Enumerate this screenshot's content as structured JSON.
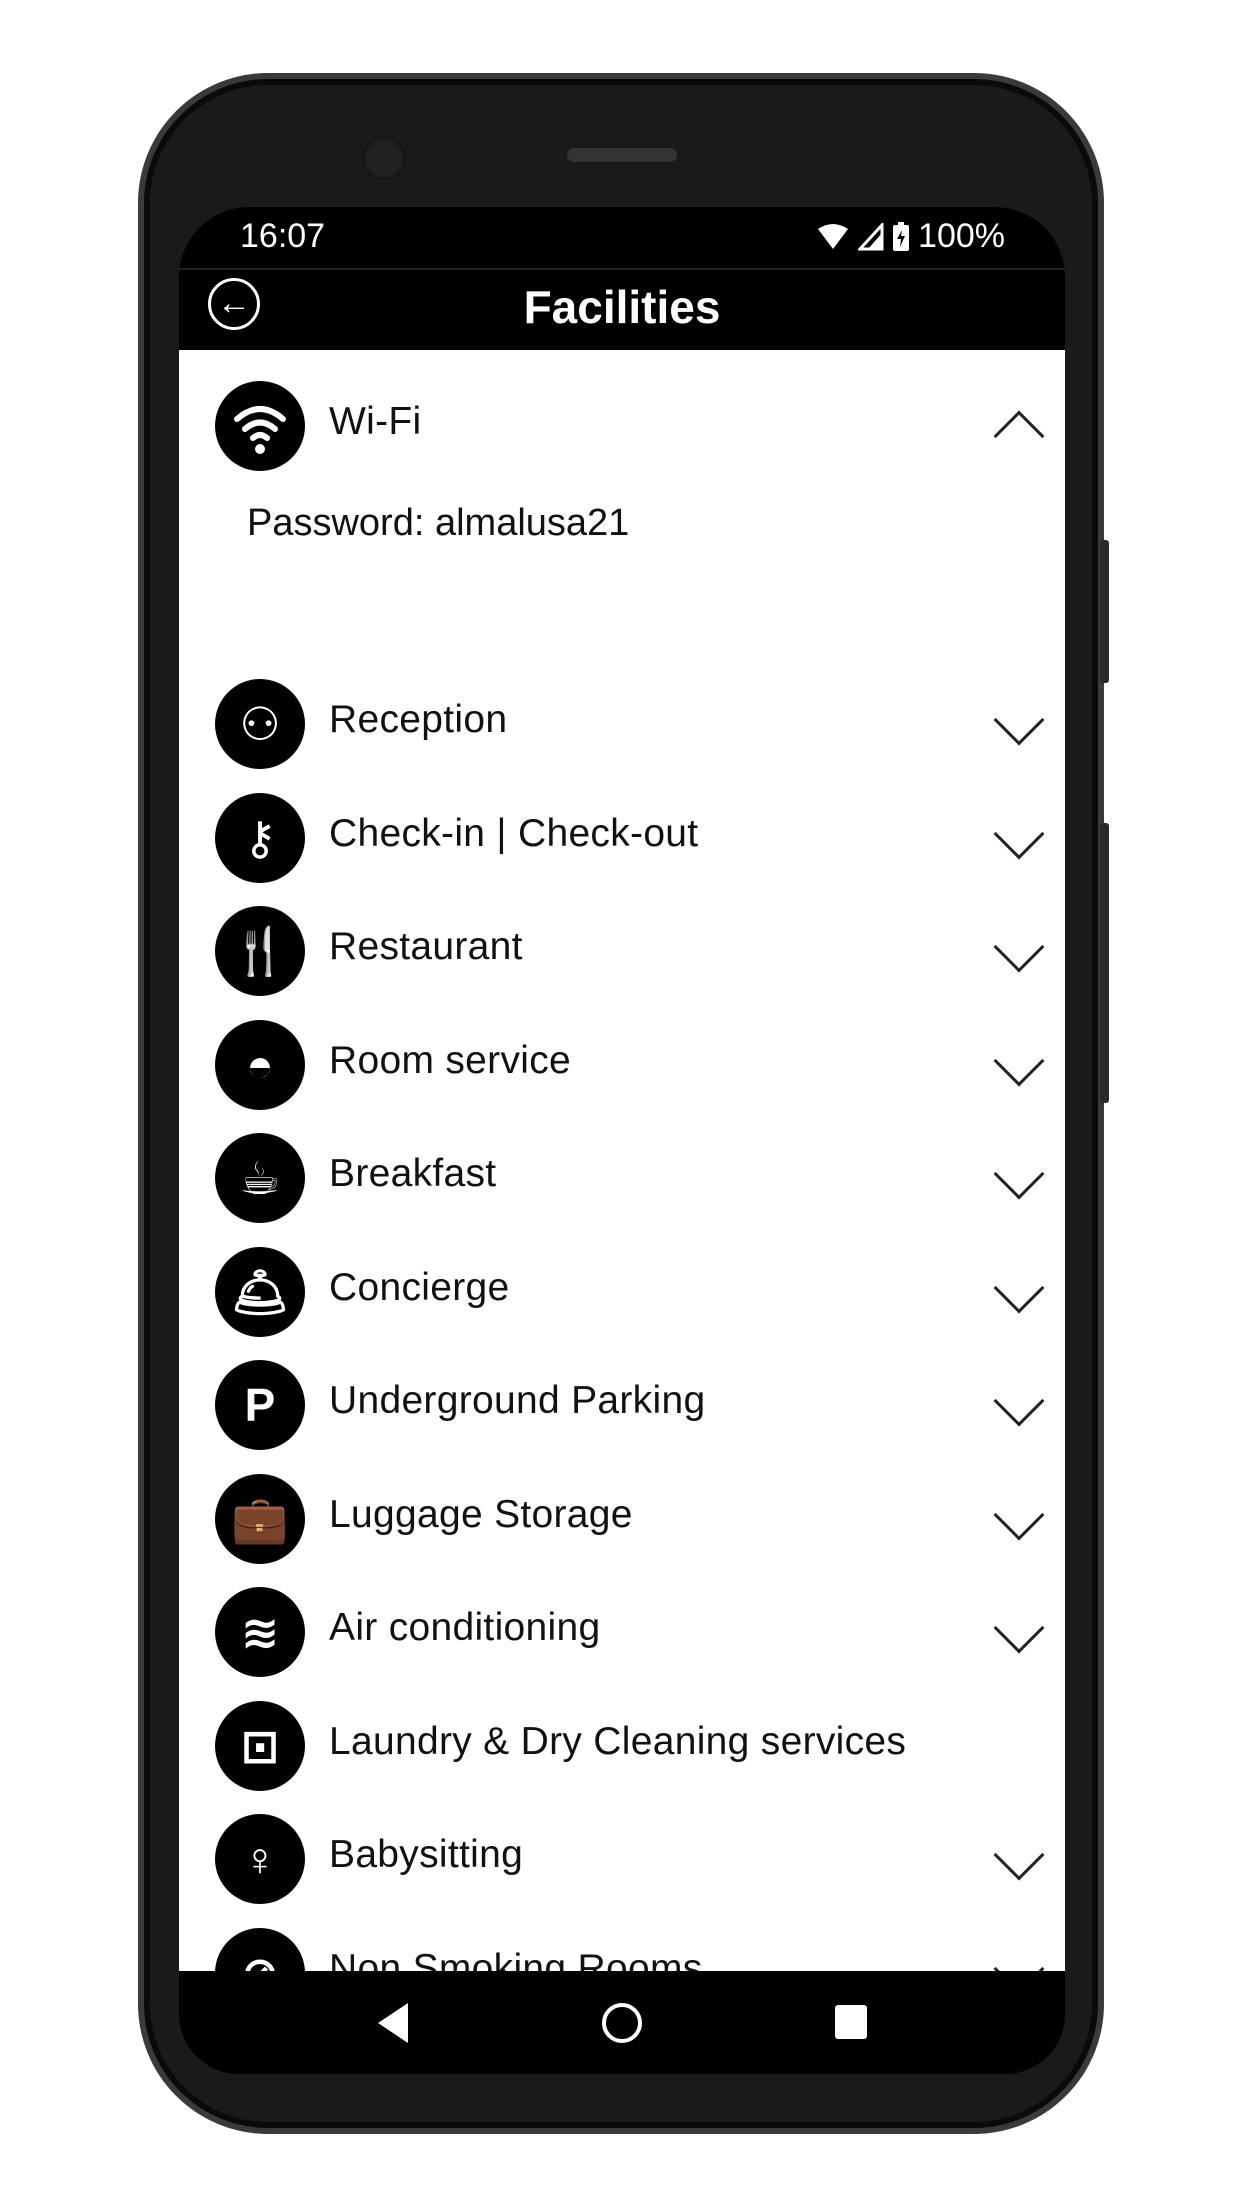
{
  "status_bar": {
    "time": "16:07",
    "battery": "100%",
    "icons": [
      "wifi-icon",
      "signal-icon",
      "battery-charging-icon"
    ]
  },
  "header": {
    "title": "Facilities",
    "back_icon": "arrow-left-circle-icon"
  },
  "wifi": {
    "label": "Wi-Fi",
    "icon": "wifi-icon",
    "expanded": true,
    "detail": "Password: almalusa21"
  },
  "items": [
    {
      "label": "Reception",
      "icon": "reception-icon",
      "chevron": true
    },
    {
      "label": "Check-in | Check-out",
      "icon": "key-icon",
      "chevron": true
    },
    {
      "label": "Restaurant",
      "icon": "fork-knife-icon",
      "chevron": true
    },
    {
      "label": "Room service",
      "icon": "cloche-icon",
      "chevron": true
    },
    {
      "label": "Breakfast",
      "icon": "coffee-cup-icon",
      "chevron": true
    },
    {
      "label": "Concierge",
      "icon": "bell-icon",
      "chevron": true
    },
    {
      "label": "Underground Parking",
      "icon": "parking-icon",
      "chevron": true
    },
    {
      "label": "Luggage Storage",
      "icon": "suitcase-icon",
      "chevron": true
    },
    {
      "label": "Air conditioning",
      "icon": "air-conditioner-icon",
      "chevron": true
    },
    {
      "label": "Laundry & Dry Cleaning services",
      "icon": "washing-machine-icon",
      "chevron": false
    },
    {
      "label": "Babysitting",
      "icon": "babysitting-icon",
      "chevron": true
    },
    {
      "label": "Non Smoking Rooms",
      "icon": "no-smoking-icon",
      "chevron": true
    }
  ],
  "glyphs": {
    "reception": "⚇",
    "key": "⚷",
    "restaurant": "🍴",
    "cloche": "◓",
    "coffee": "☕",
    "bell": "🛎",
    "parking": "P",
    "suitcase": "💼",
    "ac": "≋",
    "laundry": "⊡",
    "baby": "♀",
    "nosmoke": "⊘",
    "wifi": "⌔"
  }
}
